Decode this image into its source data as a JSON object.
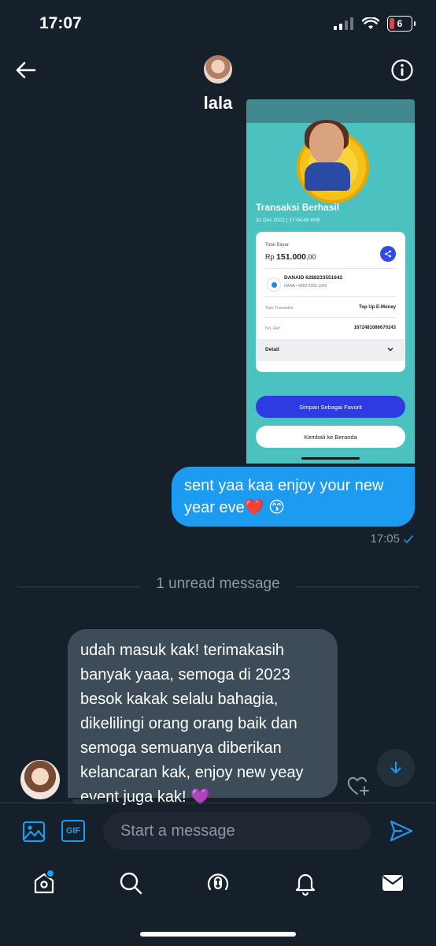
{
  "status_bar": {
    "time": "17:07",
    "battery": "6"
  },
  "header": {
    "contact_name": "lala",
    "back_icon": "arrow-left-icon",
    "info_icon": "info-icon"
  },
  "attachment": {
    "title": "Transaksi Berhasil",
    "date": "31 Des 2022 | 17:04:48 WIB",
    "total_label": "Total Bayar",
    "currency": "Rp",
    "amount": "151.000",
    "amount_decimal": ",00",
    "recipient_name": "DANAID 6288233551642",
    "recipient_sub": "DANA • 0882 3355 1642",
    "type_label": "Tipe Transaksi",
    "type_value": "Top Up E-Money",
    "ref_label": "No. Ref",
    "ref_value": "1672481086670243",
    "detail_label": "Detail",
    "save_favorite": "Simpan Sebagai Favorit",
    "back_home": "Kembali ke Beranda"
  },
  "outgoing": {
    "text": "sent yaa kaa enjoy your new year eve❤️ 😙",
    "time": "17:05"
  },
  "unread_divider": "1 unread message",
  "incoming": {
    "text": "udah masuk kak! terimakasih banyak yaaa, semoga di 2023 besok kakak selalu bahagia, dikelilingi orang orang baik dan semoga semuanya diberikan kelancaran kak, enjoy new yeay event juga kak! 💜"
  },
  "composer": {
    "placeholder": "Start a message",
    "gif_label": "GIF"
  },
  "nav": [
    "home-icon",
    "search-icon",
    "spaces-icon",
    "notifications-icon",
    "messages-icon"
  ],
  "colors": {
    "background": "#15202b",
    "accent": "#1d9bf0",
    "incoming_bubble": "#3e4c5a"
  }
}
